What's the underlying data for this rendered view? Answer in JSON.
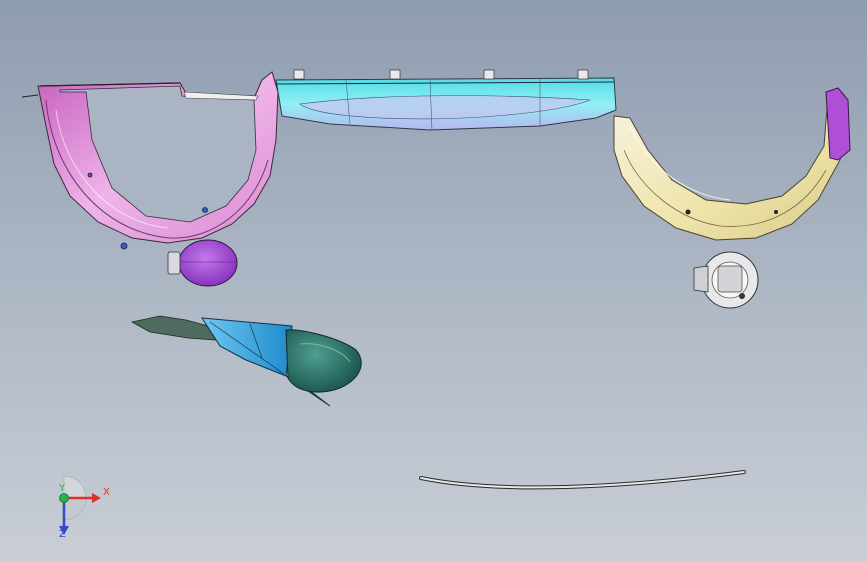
{
  "viewport": {
    "background_top": "#8f9db0",
    "background_bottom": "#c9ced6"
  },
  "triad": {
    "x_label": "X",
    "y_label": "Y",
    "z_label": "Z",
    "x_color": "#e0302a",
    "y_color": "#2bb34a",
    "z_color": "#3548c8"
  },
  "parts": [
    {
      "name": "left-wheel-arch-liner",
      "color": "#e3a6dc"
    },
    {
      "name": "rear-bumper-center-beam",
      "color": "#7fe7ee"
    },
    {
      "name": "right-wheel-arch-liner",
      "color": "#efe8b6"
    },
    {
      "name": "fuel-door-cover",
      "color": "#a84fd6"
    },
    {
      "name": "fuel-filler-housing",
      "color": "#e8e8e8"
    },
    {
      "name": "side-skirt-bracket",
      "color": "#3aa7dd"
    },
    {
      "name": "bumper-trim-strip",
      "color": "#e6e8ea"
    }
  ]
}
